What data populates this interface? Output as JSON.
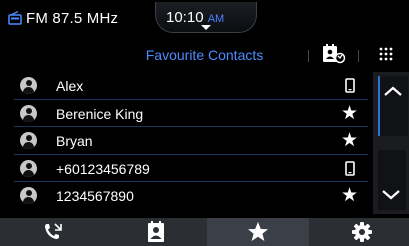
{
  "status": {
    "radio": "FM 87.5 MHz",
    "time": "10:10",
    "ampm": "AM"
  },
  "header": {
    "title": "Favourite Contacts"
  },
  "contacts": [
    {
      "name": "Alex",
      "badge": "mobile-phone-icon"
    },
    {
      "name": "Berenice King",
      "badge": "star-icon"
    },
    {
      "name": "Bryan",
      "badge": "star-icon"
    },
    {
      "name": "+60123456789",
      "badge": "mobile-phone-icon"
    },
    {
      "name": "1234567890",
      "badge": "star-icon"
    }
  ],
  "tabs": [
    {
      "icon": "call-log-icon",
      "active": false
    },
    {
      "icon": "contacts-book-icon",
      "active": false
    },
    {
      "icon": "favourites-star-icon",
      "active": true
    },
    {
      "icon": "settings-gear-icon",
      "active": false
    }
  ],
  "colors": {
    "accent": "#4d8cff",
    "background": "#000000",
    "divider": "#16365e",
    "tab_bar": "#2b2e33"
  }
}
